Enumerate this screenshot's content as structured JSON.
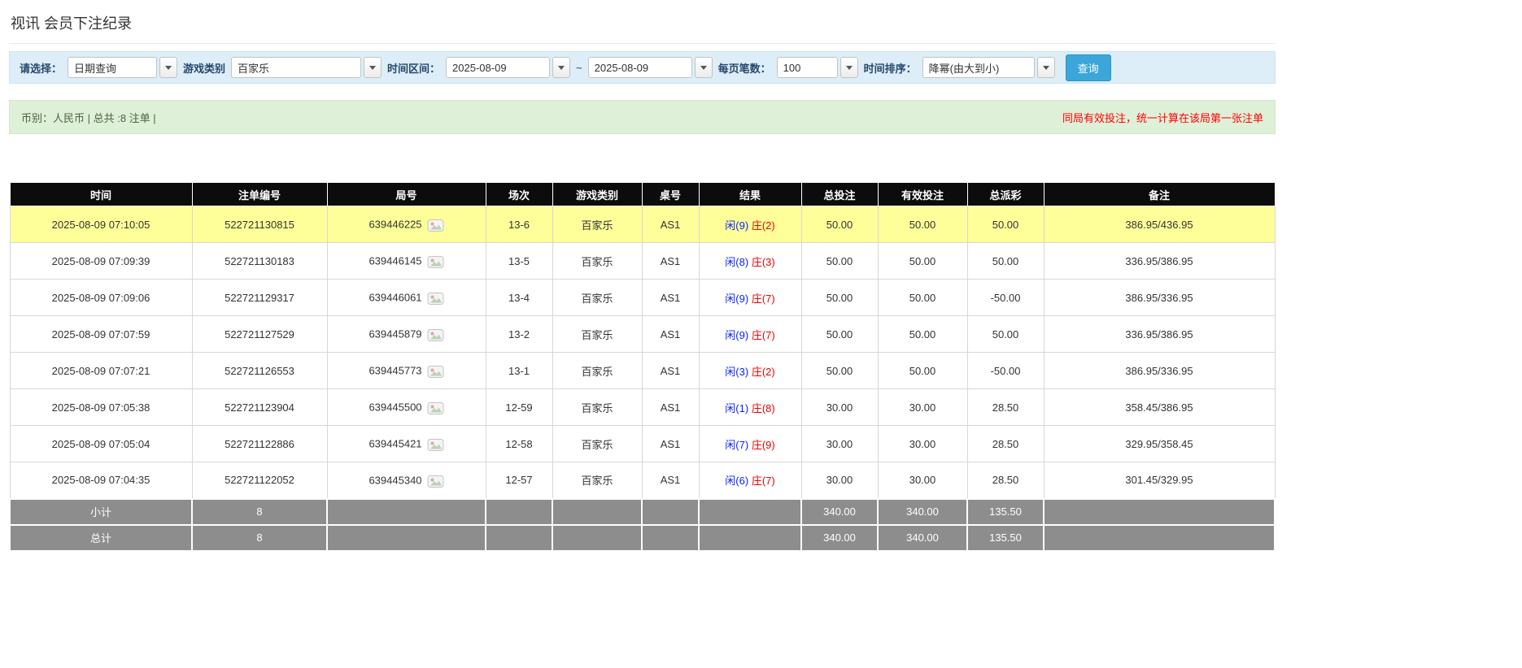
{
  "page": {
    "title": "视讯 会员下注纪录"
  },
  "colors": {
    "accent_button": "#3ba6da",
    "highlight_row": "#ffff99",
    "player_blue": "#0b24fb",
    "banker_red": "#f00000",
    "negative_red": "#ff0000",
    "link_blue": "#2f7ed8"
  },
  "filters": {
    "select_label": "请选择：",
    "select_value": "日期查询",
    "game_type_label": "游戏类别",
    "game_type_value": "百家乐",
    "time_range_label": "时间区间：",
    "date_from": "2025-08-09",
    "tilde": "~",
    "date_to": "2025-08-09",
    "page_size_label": "每页笔数：",
    "page_size_value": "100",
    "sort_label": "时间排序：",
    "sort_value": "降幂(由大到小)",
    "search_button": "查询"
  },
  "summary": {
    "left": "币别：人民币 | 总共 :8 注单 |",
    "right": "同局有效投注，统一计算在该局第一张注单"
  },
  "table": {
    "headers": [
      "时间",
      "注单编号",
      "局号",
      "场次",
      "游戏类别",
      "桌号",
      "结果",
      "总投注",
      "有效投注",
      "总派彩",
      "备注"
    ],
    "rows": [
      {
        "time": "2025-08-09 07:10:05",
        "bet_id": "522721130815",
        "round_id": "639446225",
        "session": "13-6",
        "game_type": "百家乐",
        "table_id": "AS1",
        "result_player": "闲(9)",
        "result_banker": "庄(2)",
        "total_bet": "50.00",
        "valid_bet": "50.00",
        "payout": "50.00",
        "remark": "386.95/436.95",
        "highlight": true
      },
      {
        "time": "2025-08-09 07:09:39",
        "bet_id": "522721130183",
        "round_id": "639446145",
        "session": "13-5",
        "game_type": "百家乐",
        "table_id": "AS1",
        "result_player": "闲(8)",
        "result_banker": "庄(3)",
        "total_bet": "50.00",
        "valid_bet": "50.00",
        "payout": "50.00",
        "remark": "336.95/386.95",
        "highlight": false
      },
      {
        "time": "2025-08-09 07:09:06",
        "bet_id": "522721129317",
        "round_id": "639446061",
        "session": "13-4",
        "game_type": "百家乐",
        "table_id": "AS1",
        "result_player": "闲(9)",
        "result_banker": "庄(7)",
        "total_bet": "50.00",
        "valid_bet": "50.00",
        "payout": "-50.00",
        "remark": "386.95/336.95",
        "highlight": false
      },
      {
        "time": "2025-08-09 07:07:59",
        "bet_id": "522721127529",
        "round_id": "639445879",
        "session": "13-2",
        "game_type": "百家乐",
        "table_id": "AS1",
        "result_player": "闲(9)",
        "result_banker": "庄(7)",
        "total_bet": "50.00",
        "valid_bet": "50.00",
        "payout": "50.00",
        "remark": "336.95/386.95",
        "highlight": false
      },
      {
        "time": "2025-08-09 07:07:21",
        "bet_id": "522721126553",
        "round_id": "639445773",
        "session": "13-1",
        "game_type": "百家乐",
        "table_id": "AS1",
        "result_player": "闲(3)",
        "result_banker": "庄(2)",
        "total_bet": "50.00",
        "valid_bet": "50.00",
        "payout": "-50.00",
        "remark": "386.95/336.95",
        "highlight": false
      },
      {
        "time": "2025-08-09 07:05:38",
        "bet_id": "522721123904",
        "round_id": "639445500",
        "session": "12-59",
        "game_type": "百家乐",
        "table_id": "AS1",
        "result_player": "闲(1)",
        "result_banker": "庄(8)",
        "total_bet": "30.00",
        "valid_bet": "30.00",
        "payout": "28.50",
        "remark": "358.45/386.95",
        "highlight": false
      },
      {
        "time": "2025-08-09 07:05:04",
        "bet_id": "522721122886",
        "round_id": "639445421",
        "session": "12-58",
        "game_type": "百家乐",
        "table_id": "AS1",
        "result_player": "闲(7)",
        "result_banker": "庄(9)",
        "total_bet": "30.00",
        "valid_bet": "30.00",
        "payout": "28.50",
        "remark": "329.95/358.45",
        "highlight": false
      },
      {
        "time": "2025-08-09 07:04:35",
        "bet_id": "522721122052",
        "round_id": "639445340",
        "session": "12-57",
        "game_type": "百家乐",
        "table_id": "AS1",
        "result_player": "闲(6)",
        "result_banker": "庄(7)",
        "total_bet": "30.00",
        "valid_bet": "30.00",
        "payout": "28.50",
        "remark": "301.45/329.95",
        "highlight": false
      }
    ],
    "subtotal": {
      "label": "小计",
      "count": "8",
      "total_bet": "340.00",
      "valid_bet": "340.00",
      "payout": "135.50"
    },
    "total": {
      "label": "总计",
      "count": "8",
      "total_bet": "340.00",
      "valid_bet": "340.00",
      "payout": "135.50"
    }
  }
}
